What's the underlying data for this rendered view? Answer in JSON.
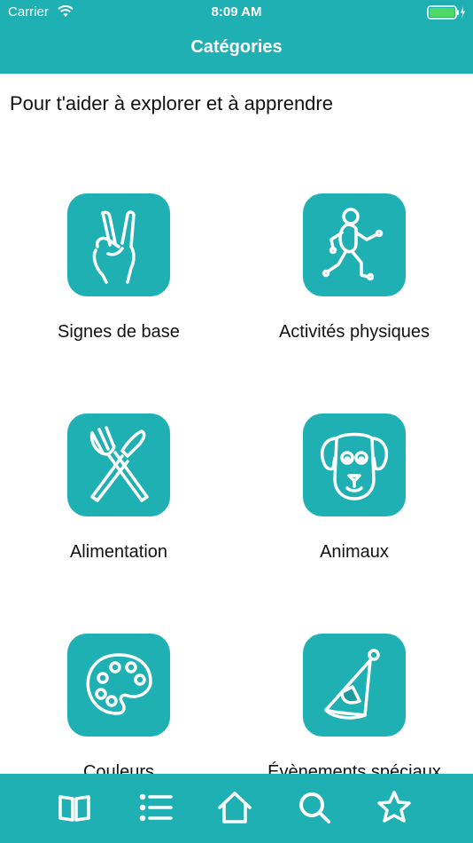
{
  "status_bar": {
    "carrier": "Carrier",
    "time": "8:09 AM"
  },
  "nav": {
    "title": "Catégories"
  },
  "intro": "Pour t'aider à explorer et à apprendre",
  "categories": [
    {
      "label": "Signes de base",
      "icon": "peace-hand-icon"
    },
    {
      "label": "Activités physiques",
      "icon": "running-person-icon"
    },
    {
      "label": "Alimentation",
      "icon": "fork-knife-icon"
    },
    {
      "label": "Animaux",
      "icon": "dog-face-icon"
    },
    {
      "label": "Couleurs",
      "icon": "palette-icon"
    },
    {
      "label": "Évènements spéciaux",
      "icon": "party-hat-icon"
    }
  ],
  "tabbar": [
    {
      "icon": "book-icon"
    },
    {
      "icon": "list-icon"
    },
    {
      "icon": "home-icon"
    },
    {
      "icon": "search-icon"
    },
    {
      "icon": "star-icon"
    }
  ],
  "colors": {
    "accent": "#1fb0b4",
    "battery": "#4cd964"
  }
}
